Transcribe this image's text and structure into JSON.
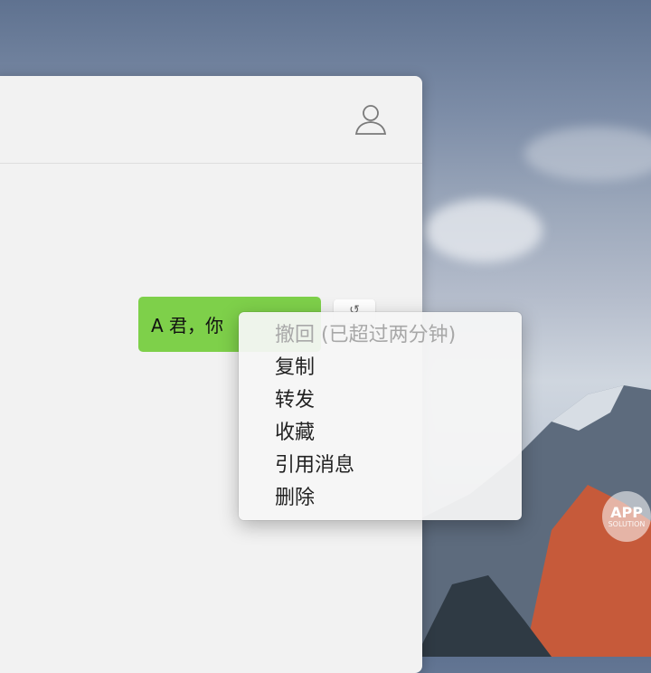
{
  "chat": {
    "message_text": "A 君，你",
    "bubble_color": "#7ed04a"
  },
  "context_menu": {
    "items": [
      {
        "label": "撤回 (已超过两分钟)",
        "enabled": false
      },
      {
        "label": "复制",
        "enabled": true
      },
      {
        "label": "转发",
        "enabled": true
      },
      {
        "label": "收藏",
        "enabled": true
      },
      {
        "label": "引用消息",
        "enabled": true
      },
      {
        "label": "删除",
        "enabled": true
      }
    ]
  },
  "watermark": {
    "top": "APP",
    "bottom": "SOLUTION"
  },
  "colors": {
    "window_bg": "#f2f2f2",
    "menu_bg": "#f5f5f5",
    "disabled_text": "#a8a8a8"
  }
}
